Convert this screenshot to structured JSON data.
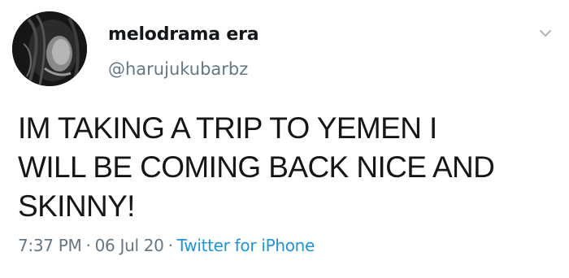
{
  "tweet": {
    "display_name": "melodrama era",
    "handle": "@harujukubarbz",
    "text": "IM TAKING A TRIP TO YEMEN I\nWILL BE COMING BACK NICE AND\nSKINNY!",
    "time": "7:37 PM",
    "date": "06 Jul 20",
    "separator": "·",
    "source": "Twitter for iPhone"
  },
  "icons": {
    "menu": "chevron-down-icon",
    "avatar": "profile-photo"
  },
  "colors": {
    "text_primary": "#14171a",
    "text_secondary": "#657786",
    "link": "#1b95e0",
    "background": "#ffffff"
  }
}
